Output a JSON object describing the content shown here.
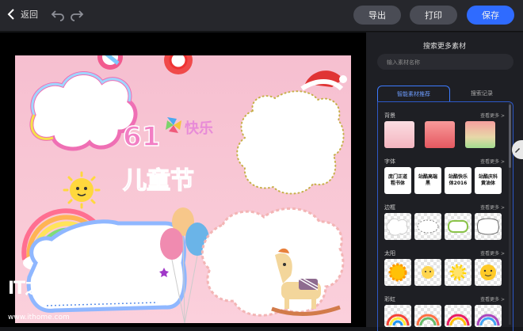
{
  "topbar": {
    "back_label": "返回",
    "export_label": "导出",
    "print_label": "打印",
    "save_label": "保存"
  },
  "poster": {
    "title_number": "61",
    "title_happy": "快乐",
    "title_day": "儿童节"
  },
  "sidebar": {
    "title": "搜索更多素材",
    "search_placeholder": "输入素材名称",
    "tabs": [
      "智能素材推荐",
      "搜索记录"
    ],
    "sections": [
      {
        "label": "背景",
        "more": "查看更多 >"
      },
      {
        "label": "字体",
        "more": "查看更多 >"
      },
      {
        "label": "边框",
        "more": "查看更多 >"
      },
      {
        "label": "太阳",
        "more": "查看更多 >"
      },
      {
        "label": "彩虹",
        "more": "查看更多 >"
      }
    ],
    "font_samples": [
      "庞门正道\n粗书体",
      "站酷高端\n黑",
      "站酷快乐\n体2016",
      "站酷庆科\n黄油体"
    ],
    "background_colors": [
      "#f7c5cd",
      "#ec6d75",
      "#f4b8a4"
    ]
  },
  "watermark": {
    "url": "www.ithome.com"
  },
  "colors": {
    "accent": "#2f6bff",
    "poster_bg": "#f8c4d3"
  }
}
